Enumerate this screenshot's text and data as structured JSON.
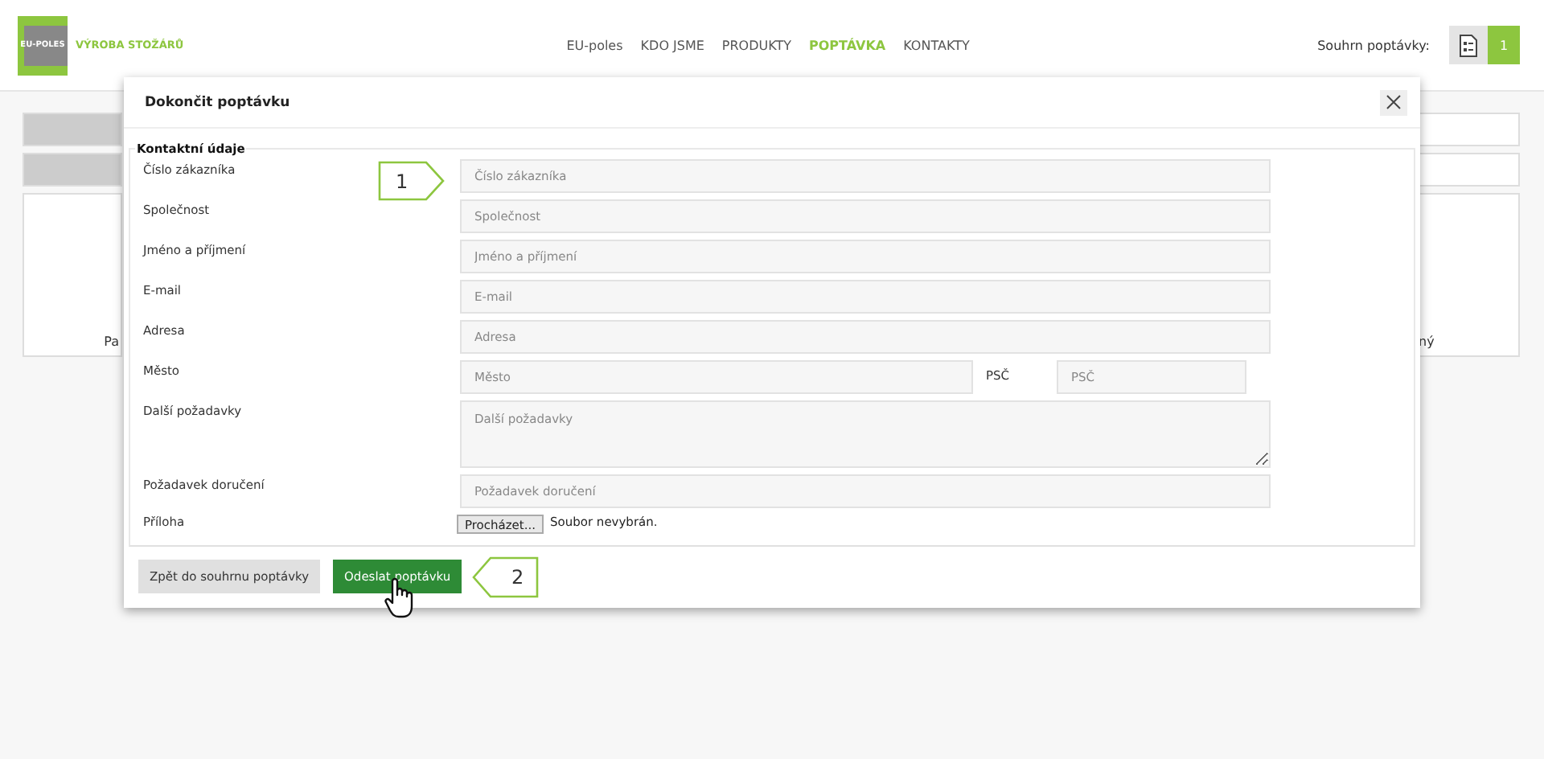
{
  "header": {
    "logo_text": "EU-POLES",
    "brand": "VÝROBA STOŽÁRŮ",
    "nav": [
      {
        "label": "EU-poles",
        "selected": false
      },
      {
        "label": "KDO JSME",
        "selected": false
      },
      {
        "label": "PRODUKTY",
        "selected": false
      },
      {
        "label": "POPTÁVKA",
        "selected": true
      },
      {
        "label": "KONTAKTY",
        "selected": false
      }
    ],
    "summary_label": "Souhrn poptávky:",
    "cart_count": "1"
  },
  "background": {
    "left_text": "Pa",
    "right_text": "ný"
  },
  "modal": {
    "title": "Dokončit poptávku",
    "legend": "Kontaktní údaje",
    "fields": [
      {
        "kind": "input",
        "label": "Číslo zákazníka",
        "placeholder": "Číslo zákazníka"
      },
      {
        "kind": "input",
        "label": "Společnost",
        "placeholder": "Společnost"
      },
      {
        "kind": "input",
        "label": "Jméno a příjmení",
        "placeholder": "Jméno a příjmení"
      },
      {
        "kind": "input",
        "label": "E-mail",
        "placeholder": "E-mail"
      },
      {
        "kind": "input",
        "label": "Adresa",
        "placeholder": "Adresa"
      },
      {
        "kind": "split",
        "label": "Město",
        "placeholder": "Město",
        "second_label": "PSČ",
        "second_placeholder": "PSČ"
      },
      {
        "kind": "textarea",
        "label": "Další požadavky",
        "placeholder": "Další požadavky"
      },
      {
        "kind": "input",
        "label": "Požadavek doručení",
        "placeholder": "Požadavek doručení"
      },
      {
        "kind": "file",
        "label": "Příloha",
        "button": "Procházet...",
        "status": "Soubor nevybrán."
      }
    ],
    "back_button": "Zpět do souhrnu poptávky",
    "submit_button": "Odeslat poptávku"
  },
  "callouts": [
    "1",
    "2"
  ]
}
